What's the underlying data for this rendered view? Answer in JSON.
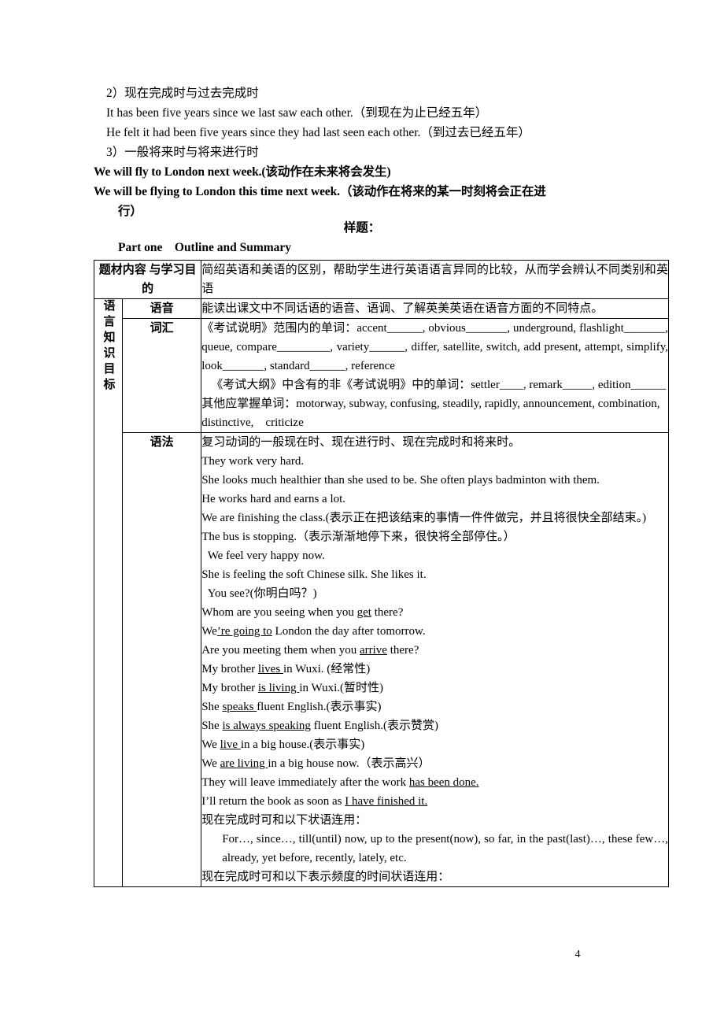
{
  "document": {
    "page_number": "4"
  },
  "prose": {
    "lines": [
      {
        "text": "2）现在完成时与过去完成时",
        "style": "indent"
      },
      {
        "text": "It has been five years since we last saw each other.（到现在为止已经五年）",
        "style": "indent2"
      },
      {
        "text": "He felt it had been five years since they had last seen each other.（到过去已经五年）",
        "style": "indent2"
      },
      {
        "text": "3）一般将来时与将来进行时",
        "style": "indent"
      },
      {
        "text": "We will fly to London next week.(该动作在未来将会发生)",
        "style": "bold"
      },
      {
        "text": "We will be flying to London this time next week.（该动作在将来的某一时刻将会正在进",
        "style": "bold"
      },
      {
        "text": "行）",
        "style": "bold-hang"
      }
    ]
  },
  "sample": {
    "title": "样题：",
    "part_one": "Part one　Outline and Summary"
  },
  "table": {
    "rows": {
      "topic": {
        "label": "题材内容\n与学习目的",
        "content": "简绍英语和美语的区别，帮助学生进行英语语言异同的比较，从而学会辨认不同类别和英语"
      },
      "vertical_label": "语言知识目标",
      "pronunciation": {
        "label": "语音",
        "content": "能读出课文中不同话语的语音、语调、了解英美英语在语音方面的不同特点。"
      },
      "vocabulary": {
        "label": "词汇",
        "lines": [
          "《考试说明》范围内的单词：accent______, obvious_______, underground, flashlight_______, queue, compare_________, variety______, differ, satellite, switch, add present, attempt, simplify, look_______, standard______, reference",
          "《考试大纲》中含有的非《考试说明》中的单词：settler____, remark_____, edition______",
          "其他应掌握单词：motorway, subway, confusing, steadily, rapidly, announcement, combination, distinctive,　criticize"
        ]
      },
      "grammar": {
        "label": "语法",
        "lines": [
          {
            "text": "复习动词的一般现在时、现在进行时、现在完成时和将来时。",
            "kind": "plain"
          },
          {
            "text": "They work very hard.",
            "kind": "plain"
          },
          {
            "text": "She looks much healthier than she used to be. She often plays badminton with them.",
            "kind": "plain"
          },
          {
            "text": "He works hard and earns a lot.",
            "kind": "plain"
          },
          {
            "text": "We are finishing the class.(表示正在把该结束的事情一件件做完，并且将很快全部结束。)",
            "kind": "wrap"
          },
          {
            "text": "The bus is stopping.（表示渐渐地停下来，很快将全部停住。）",
            "kind": "plain"
          },
          {
            "text": "  We feel very happy now.",
            "kind": "plain"
          },
          {
            "text": "She is feeling the soft Chinese silk. She likes it.",
            "kind": "plain"
          },
          {
            "text": "  You see?(你明白吗？)",
            "kind": "plain"
          },
          {
            "text": "Whom are you seeing when you get there?",
            "kind": "u",
            "underline": "get"
          },
          {
            "text": "We’re going to London the day after tomorrow.",
            "kind": "u",
            "underline": "’re going to"
          },
          {
            "text": "Are you meeting them when you arrive there?",
            "kind": "u",
            "underline": "arrive"
          },
          {
            "text": "My brother lives in Wuxi. (经常性)",
            "kind": "u",
            "underline": "lives "
          },
          {
            "text": "My brother is living in Wuxi.(暂时性)",
            "kind": "u",
            "underline": "is living "
          },
          {
            "text": "She speaks fluent English.(表示事实)",
            "kind": "u",
            "underline": "speaks "
          },
          {
            "text": "She is always speaking fluent English.(表示赞赏)",
            "kind": "u",
            "underline": "is always speaking"
          },
          {
            "text": "We live in a big house.(表示事实)",
            "kind": "u",
            "underline": "live "
          },
          {
            "text": "We are living in a big house now.（表示高兴）",
            "kind": "u",
            "underline": "are living "
          },
          {
            "text": "They will leave immediately after the work has been done.",
            "kind": "u",
            "underline": "has been done."
          },
          {
            "text": "I’ll return the book as soon as I have finished it.",
            "kind": "u",
            "underline": "I have finished it."
          },
          {
            "text": "现在完成时可和以下状语连用：",
            "kind": "plain"
          },
          {
            "text": "For…, since…, till(until) now, up to the present(now), so far, in the past(last)…, these few…, already, yet before, recently, lately, etc.",
            "kind": "indent-justify"
          },
          {
            "text": "现在完成时可和以下表示频度的时间状语连用：",
            "kind": "plain"
          }
        ]
      }
    }
  }
}
